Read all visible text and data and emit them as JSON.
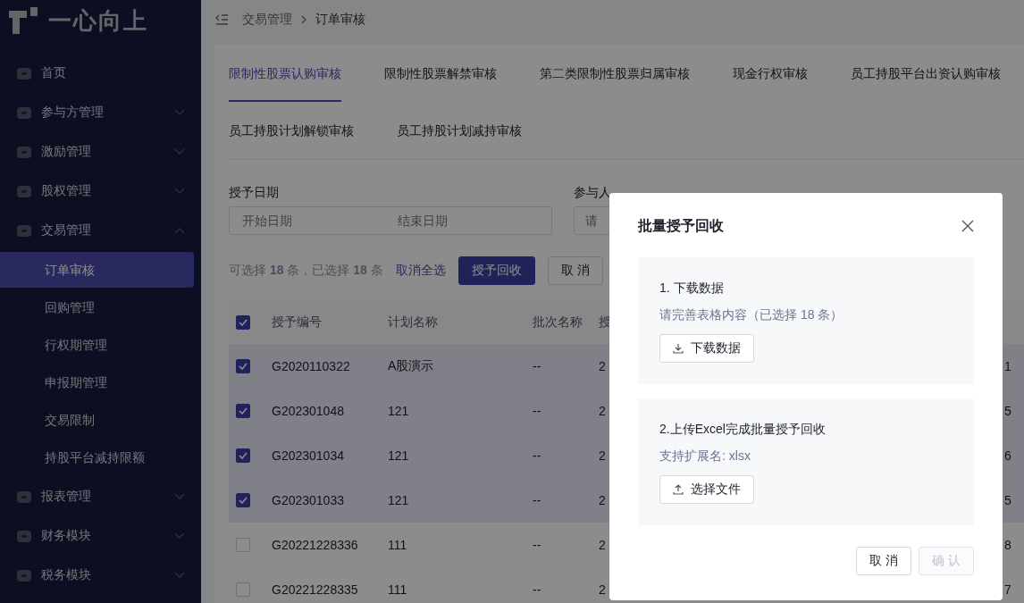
{
  "sidebar": {
    "logo": "一心向上",
    "items": [
      {
        "label": "首页"
      },
      {
        "label": "参与方管理",
        "expanded": false
      },
      {
        "label": "激励管理",
        "expanded": false
      },
      {
        "label": "股权管理",
        "expanded": false
      },
      {
        "label": "交易管理",
        "expanded": true,
        "children": [
          {
            "label": "订单审核",
            "selected": true
          },
          {
            "label": "回购管理",
            "selected": false
          },
          {
            "label": "行权期管理",
            "selected": false
          },
          {
            "label": "申报期管理",
            "selected": false
          },
          {
            "label": "交易限制",
            "selected": false
          },
          {
            "label": "持股平台减持限额",
            "selected": false
          }
        ]
      },
      {
        "label": "报表管理",
        "expanded": false
      },
      {
        "label": "财务模块",
        "expanded": false
      },
      {
        "label": "税务模块",
        "expanded": false
      }
    ]
  },
  "breadcrumb": [
    "交易管理",
    "订单审核"
  ],
  "tabs": [
    {
      "label": "限制性股票认购审核",
      "selected": true
    },
    {
      "label": "限制性股票解禁审核",
      "selected": false
    },
    {
      "label": "第二类限制性股票归属审核",
      "selected": false
    },
    {
      "label": "现金行权审核",
      "selected": false
    },
    {
      "label": "员工持股平台出资认购审核",
      "selected": false
    },
    {
      "label": "员工持股计划解锁审核",
      "selected": false
    },
    {
      "label": "员工持股计划减持审核",
      "selected": false
    }
  ],
  "filters": {
    "grant_date": {
      "label": "授予日期",
      "start_placeholder": "开始日期",
      "end_placeholder": "结束日期"
    },
    "participant": {
      "label": "参与人",
      "placeholder": "请"
    }
  },
  "selection": {
    "summary": "可选择 **18** 条，已选择 **18** 条",
    "clear_link": "取消全选",
    "primary_button": "授予回收",
    "cancel_button": "取 消"
  },
  "table": {
    "all_checked": true,
    "columns": [
      "授予编号",
      "计划名称",
      "批次名称",
      "授"
    ],
    "rows": [
      {
        "checked": true,
        "cells": [
          "G2020110322",
          "A股演示",
          "--",
          "2"
        ],
        "column_6": "1"
      },
      {
        "checked": true,
        "cells": [
          "G202301048",
          "121",
          "--",
          "2"
        ],
        "column_6": "5"
      },
      {
        "checked": true,
        "cells": [
          "G202301034",
          "121",
          "--",
          "2"
        ],
        "column_6": "6"
      },
      {
        "checked": true,
        "cells": [
          "G202301033",
          "121",
          "--",
          "2"
        ],
        "column_6": "5"
      },
      {
        "checked": false,
        "cells": [
          "G20221228336",
          "111",
          "--",
          "2"
        ],
        "column_6": "8"
      },
      {
        "checked": false,
        "cells": [
          "G20221228335",
          "111",
          "--",
          "2"
        ],
        "column_6": "7"
      }
    ]
  },
  "dialog": {
    "title": "批量授予回收",
    "steps": [
      {
        "kind": "download",
        "title": "1. 下载数据",
        "hint": "请完善表格内容（已选择 18 条）",
        "button": "下载数据"
      },
      {
        "kind": "upload",
        "title": "2.上传Excel完成批量授予回收",
        "hint": "支持扩展名: xlsx",
        "button": "选择文件"
      }
    ],
    "cancel_button": "取 消",
    "confirm_button": {
      "label": "确 认",
      "disabled": true
    }
  }
}
